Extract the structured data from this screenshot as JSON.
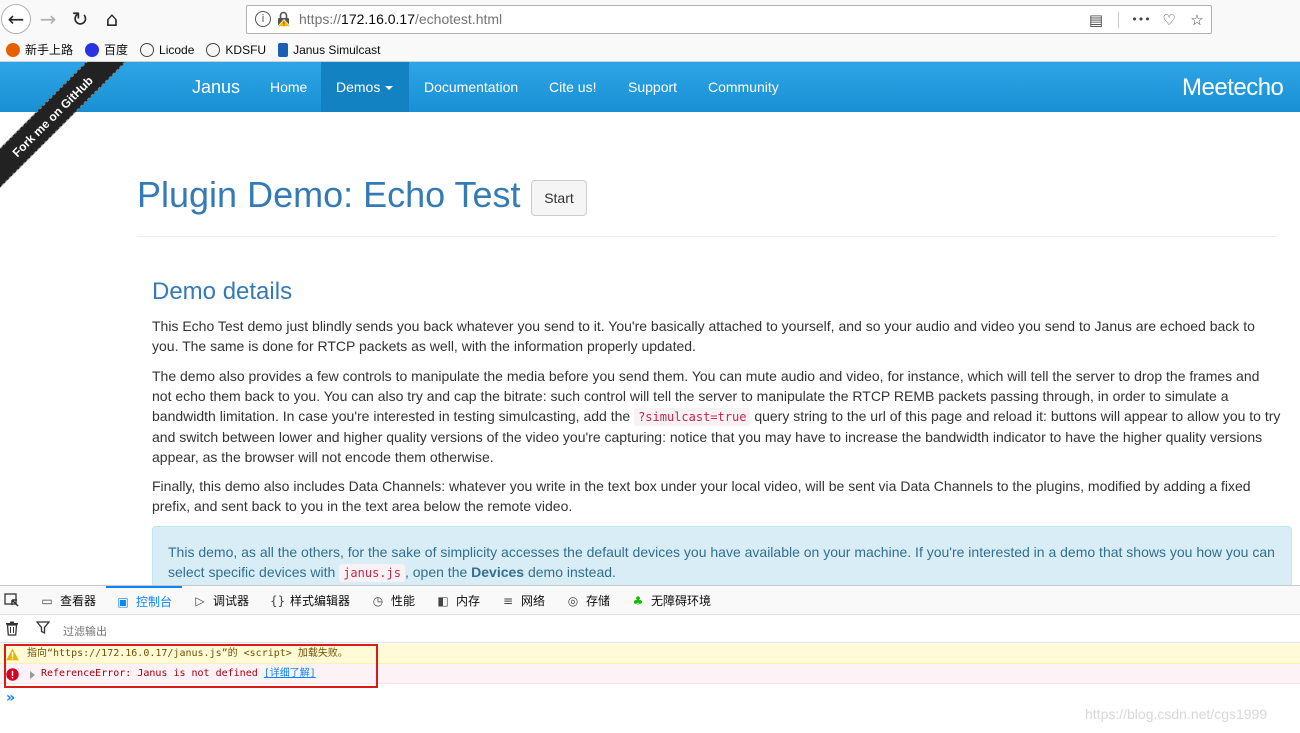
{
  "browser": {
    "back_icon": "←",
    "forward_icon": "→",
    "reload_icon": "↻",
    "home_icon": "⌂",
    "info_icon": "i",
    "url_prefix": "https://",
    "url_host": "172.16.0.17",
    "url_path": "/echotest.html",
    "reader_icon": "▤",
    "more_icon": "•••",
    "pocket_icon": "♡",
    "star_icon": "☆"
  },
  "bookmarks": [
    {
      "label": "新手上路",
      "color": "#e66000"
    },
    {
      "label": "百度",
      "color": "#2932e1"
    },
    {
      "label": "Licode",
      "color": "#444444"
    },
    {
      "label": "KDSFU",
      "color": "#444444"
    },
    {
      "label": "Janus Simulcast",
      "color": "#1a5fb4"
    }
  ],
  "navbar": {
    "brand": "Janus",
    "links": [
      "Home",
      "Demos",
      "Documentation",
      "Cite us!",
      "Support",
      "Community"
    ],
    "logo": "Meetecho"
  },
  "ribbon": "Fork me on GitHub",
  "page": {
    "title": "Plugin Demo: Echo Test",
    "start_button": "Start",
    "section_title": "Demo details",
    "p1": "This Echo Test demo just blindly sends you back whatever you send to it. You're basically attached to yourself, and so your audio and video you send to Janus are echoed back to you. The same is done for RTCP packets as well, with the information properly updated.",
    "p2_a": "The demo also provides a few controls to manipulate the media before you send them. You can mute audio and video, for instance, which will tell the server to drop the frames and not echo them back to you. You can also try and cap the bitrate: such control will tell the server to manipulate the RTCP REMB packets passing through, in order to simulate a bandwidth limitation. In case you're interested in testing simulcasting, add the ",
    "p2_code": "?simulcast=true",
    "p2_b": " query string to the url of this page and reload it: buttons will appear to allow you to try and switch between lower and higher quality versions of the video you're capturing: notice that you may have to increase the bandwidth indicator to have the higher quality versions appear, as the browser will not encode them otherwise.",
    "p3": "Finally, this demo also includes Data Channels: whatever you write in the text box under your local video, will be sent via Data Channels to the plugins, modified by adding a fixed prefix, and sent back to you in the text area below the remote video.",
    "alert_a": "This demo, as all the others, for the sake of simplicity accesses the default devices you have available on your machine. If you're interested in a demo that shows you how you can select specific devices with ",
    "alert_code": "janus.js",
    "alert_b": ", open the ",
    "alert_strong": "Devices",
    "alert_c": " demo instead."
  },
  "devtools": {
    "tabs": [
      {
        "label": "查看器",
        "icon": "▭"
      },
      {
        "label": "控制台",
        "icon": "▣"
      },
      {
        "label": "调试器",
        "icon": "▷"
      },
      {
        "label": "样式编辑器",
        "icon": "{}"
      },
      {
        "label": "性能",
        "icon": "◷"
      },
      {
        "label": "内存",
        "icon": "◧"
      },
      {
        "label": "网络",
        "icon": "≡"
      },
      {
        "label": "存储",
        "icon": "◎"
      },
      {
        "label": "无障碍环境",
        "icon": "♣"
      }
    ],
    "active_tab": "控制台",
    "filter_placeholder": "过滤输出",
    "warning": "指向“https://172.16.0.17/janus.js”的 <script> 加载失败。",
    "error": "ReferenceError: Janus is not defined",
    "error_link": "[详细了解]",
    "prompt": "»"
  },
  "watermark": "https://blog.csdn.net/cgs1999",
  "colors": {
    "navbar": "#1e96da",
    "title_blue": "#337ab7",
    "alert_bg": "#d9edf7",
    "highlight_box": "#d81b1b"
  }
}
